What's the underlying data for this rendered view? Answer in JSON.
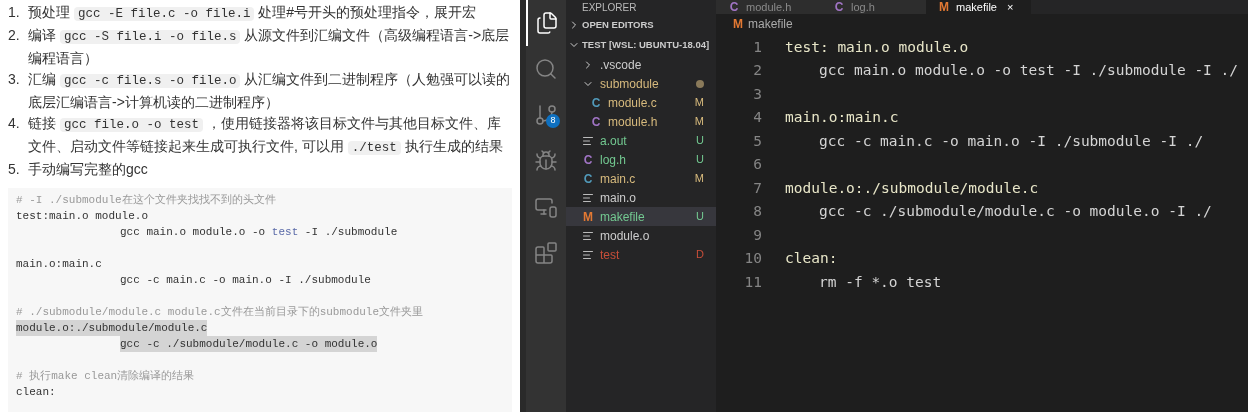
{
  "document": {
    "steps": [
      {
        "number": "1.",
        "parts": [
          {
            "kind": "text",
            "text": "预处理 "
          },
          {
            "kind": "code",
            "text": "gcc -E file.c -o file.i"
          },
          {
            "kind": "text",
            "text": " 处理#号开头的预处理指令，展开宏"
          }
        ]
      },
      {
        "number": "2.",
        "parts": [
          {
            "kind": "text",
            "text": "编译 "
          },
          {
            "kind": "code",
            "text": "gcc -S file.i -o file.s"
          },
          {
            "kind": "text",
            "text": " 从源文件到汇编文件（高级编程语言->底层编程语言）"
          }
        ]
      },
      {
        "number": "3.",
        "parts": [
          {
            "kind": "text",
            "text": "汇编 "
          },
          {
            "kind": "code",
            "text": "gcc -c file.s -o file.o"
          },
          {
            "kind": "text",
            "text": " 从汇编文件到二进制程序（人勉强可以读的底层汇编语言->计算机读的二进制程序）"
          }
        ]
      },
      {
        "number": "4.",
        "parts": [
          {
            "kind": "text",
            "text": "链接 "
          },
          {
            "kind": "code",
            "text": "gcc file.o -o test"
          },
          {
            "kind": "text",
            "text": " ，使用链接器将该目标文件与其他目标文件、库文件、启动文件等链接起来生成可执行文件, 可以用 "
          },
          {
            "kind": "code",
            "text": "./test"
          },
          {
            "kind": "text",
            "text": " 执行生成的结果"
          }
        ]
      },
      {
        "number": "5.",
        "parts": [
          {
            "kind": "text",
            "text": "手动编写完整的gcc"
          }
        ]
      }
    ],
    "code_block": [
      {
        "kind": "comment",
        "parts": [
          {
            "kind": "plain",
            "text": "# -I ./submodule在这个文件夹找找不到的头文件"
          }
        ]
      },
      {
        "kind": "code",
        "parts": [
          {
            "kind": "plain",
            "text": "test:main.o module.o"
          }
        ]
      },
      {
        "kind": "recipe",
        "parts": [
          {
            "kind": "plain",
            "text": "gcc main.o module.o -o "
          },
          {
            "kind": "keyword",
            "text": "test"
          },
          {
            "kind": "plain",
            "text": " -I ./submodule"
          }
        ]
      },
      {
        "kind": "blank"
      },
      {
        "kind": "code",
        "parts": [
          {
            "kind": "plain",
            "text": "main.o:main.c"
          }
        ]
      },
      {
        "kind": "recipe",
        "parts": [
          {
            "kind": "plain",
            "text": "gcc -c main.c -o main.o -I ./submodule"
          }
        ]
      },
      {
        "kind": "blank"
      },
      {
        "kind": "comment",
        "parts": [
          {
            "kind": "plain",
            "text": "# ./submodule/module.c module.c文件在当前目录下的submodule文件夹里"
          }
        ]
      },
      {
        "kind": "code",
        "highlighted": true,
        "parts": [
          {
            "kind": "plain",
            "text": "module.o:./submodule/module.c"
          }
        ]
      },
      {
        "kind": "recipe",
        "highlighted": true,
        "parts": [
          {
            "kind": "plain",
            "text": "gcc -c ./submodule/module.c -o module.o"
          }
        ]
      },
      {
        "kind": "blank"
      },
      {
        "kind": "comment",
        "parts": [
          {
            "kind": "plain",
            "text": "# 执行make clean清除编译的结果"
          }
        ]
      },
      {
        "kind": "code",
        "parts": [
          {
            "kind": "plain",
            "text": "clean:"
          }
        ]
      }
    ]
  },
  "vscode": {
    "activity_bar": [
      {
        "kind": "explorer",
        "selected": true
      },
      {
        "kind": "search",
        "selected": false
      },
      {
        "kind": "source-control",
        "selected": false,
        "badge": "8"
      },
      {
        "kind": "run",
        "selected": false
      },
      {
        "kind": "remote",
        "selected": false
      },
      {
        "kind": "extensions",
        "selected": false
      }
    ],
    "sidebar": {
      "title": "EXPLORER",
      "sections": [
        {
          "label": "OPEN EDITORS",
          "expanded": false
        },
        {
          "label": "TEST [WSL: UBUNTU-18.04]",
          "expanded": true
        }
      ],
      "tree": [
        {
          "kind": "folder",
          "name": ".vscode",
          "expanded": false,
          "color": "#cccccc",
          "selected": false
        },
        {
          "kind": "folder",
          "name": "submodule",
          "expanded": true,
          "modified_dot": true,
          "color": "#d7ba7d",
          "selected": false,
          "children": [
            {
              "kind": "c",
              "icon": "C",
              "name": "module.c",
              "status": "M",
              "color": "#d7ba7d",
              "selected": false
            },
            {
              "kind": "h",
              "icon": "C",
              "name": "module.h",
              "status": "M",
              "color": "#d7ba7d",
              "selected": false
            }
          ]
        },
        {
          "kind": "file",
          "name": "a.out",
          "status": "U",
          "color": "#73c991",
          "selected": false
        },
        {
          "kind": "h",
          "icon": "C",
          "name": "log.h",
          "status": "U",
          "color": "#73c991",
          "selected": false
        },
        {
          "kind": "c",
          "icon": "C",
          "name": "main.c",
          "status": "M",
          "color": "#d7ba7d",
          "selected": false
        },
        {
          "kind": "file",
          "name": "main.o",
          "color": "#cccccc",
          "selected": false
        },
        {
          "kind": "makefile",
          "icon": "M",
          "name": "makefile",
          "status": "U",
          "color": "#73c991",
          "selected": true
        },
        {
          "kind": "file",
          "name": "module.o",
          "color": "#cccccc",
          "selected": false
        },
        {
          "kind": "file",
          "name": "test",
          "status": "D",
          "color": "#c74e39",
          "selected": false
        }
      ]
    },
    "tabs": [
      {
        "kind": "h",
        "icon": "C",
        "label": "module.h",
        "selected": false
      },
      {
        "kind": "h",
        "icon": "C",
        "label": "log.h",
        "selected": false
      },
      {
        "kind": "makefile",
        "icon": "M",
        "label": "makefile",
        "selected": true,
        "close": "×"
      }
    ],
    "breadcrumb": {
      "kind": "makefile",
      "icon": "M",
      "label": "makefile"
    },
    "lines": [
      {
        "number": "1",
        "kind": "target",
        "text": "test: main.o module.o"
      },
      {
        "number": "2",
        "kind": "recipe",
        "text": "gcc main.o module.o -o test -I ./submodule -I ./"
      },
      {
        "number": "3",
        "kind": "blank"
      },
      {
        "number": "4",
        "kind": "target",
        "text": "main.o:main.c"
      },
      {
        "number": "5",
        "kind": "recipe",
        "text": "gcc -c main.c -o main.o -I ./submodule -I ./"
      },
      {
        "number": "6",
        "kind": "blank"
      },
      {
        "number": "7",
        "kind": "target",
        "text": "module.o:./submodule/module.c"
      },
      {
        "number": "8",
        "kind": "recipe",
        "text": "gcc -c ./submodule/module.c -o module.o -I ./"
      },
      {
        "number": "9",
        "kind": "blank"
      },
      {
        "number": "10",
        "kind": "target",
        "text": "clean:"
      },
      {
        "number": "11",
        "kind": "recipe",
        "text": "rm -f *.o test"
      }
    ]
  }
}
